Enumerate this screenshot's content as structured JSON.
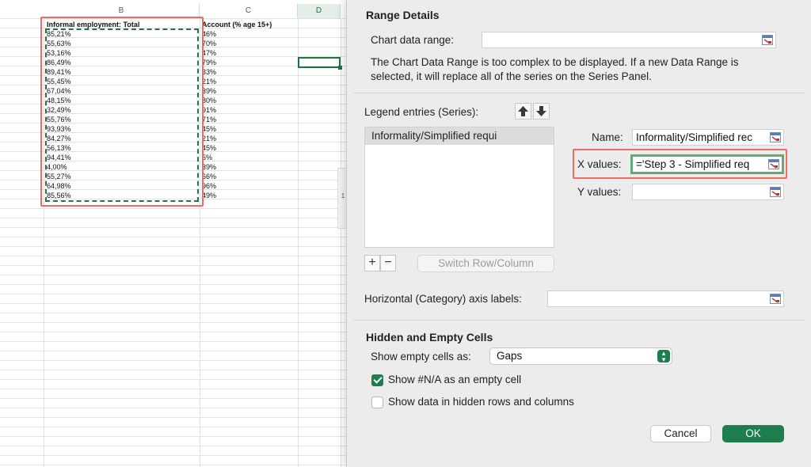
{
  "sheet": {
    "columns": [
      "B",
      "C",
      "D"
    ],
    "header_b": "Informal employment: Total",
    "header_c": "Account (% age 15+)",
    "col_b": [
      "85,21%",
      "55,63%",
      "53,16%",
      "86,49%",
      "89,41%",
      "55,45%",
      "67,04%",
      "48,15%",
      "32,49%",
      "55,76%",
      "93,93%",
      "84,27%",
      "56,13%",
      "94,41%",
      "4,00%",
      "55,27%",
      "64,98%",
      "85,56%"
    ],
    "col_c": [
      "46%",
      "70%",
      "47%",
      "79%",
      "33%",
      "21%",
      "39%",
      "80%",
      "91%",
      "71%",
      "45%",
      "21%",
      "45%",
      "5%",
      "39%",
      "66%",
      "96%",
      "49%"
    ],
    "side_tab": "1"
  },
  "dialog": {
    "section_range": "Range Details",
    "chart_data_range_label": "Chart data range:",
    "chart_data_range_value": "",
    "range_note": "The Chart Data Range is too complex to be displayed. If a new Data Range is selected, it will replace all of the series on the Series Panel.",
    "legend_label": "Legend entries (Series):",
    "series": [
      "Informality/Simplified requi"
    ],
    "name_label": "Name:",
    "name_value": "Informality/Simplified rec",
    "x_label": "X values:",
    "x_value": "='Step 3 - Simplified req",
    "y_label": "Y values:",
    "y_value": "",
    "switch_label": "Switch Row/Column",
    "plus": "+",
    "minus": "−",
    "haxis_label": "Horizontal (Category) axis labels:",
    "haxis_value": "",
    "section_hidden": "Hidden and Empty Cells",
    "empty_label": "Show empty cells as:",
    "empty_value": "Gaps",
    "na_label": "Show #N/A as an empty cell",
    "na_checked": true,
    "hidden_label": "Show data in hidden rows and columns",
    "hidden_checked": false,
    "cancel": "Cancel",
    "ok": "OK"
  },
  "colors": {
    "accent": "#1e7d4d",
    "highlight": "#ef6b63"
  },
  "icons": [
    "range-picker-icon",
    "arrow-up-icon",
    "arrow-down-icon",
    "chevron-updown-icon",
    "checkmark-icon"
  ]
}
